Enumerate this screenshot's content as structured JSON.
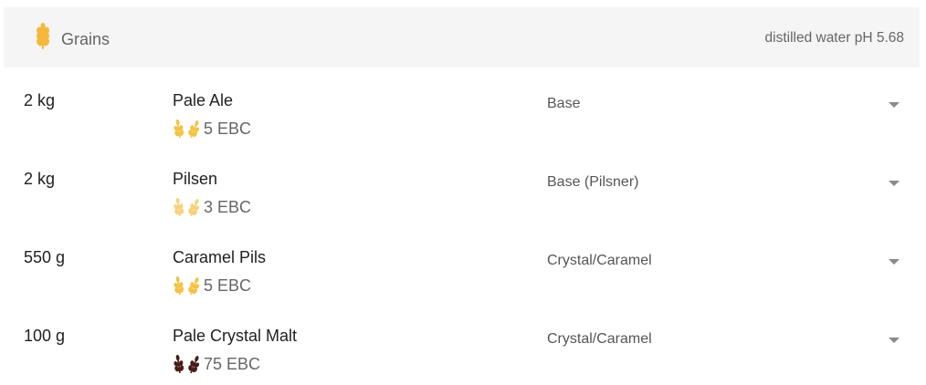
{
  "header": {
    "title": "Grains",
    "water_note": "distilled water pH 5.68",
    "icon": "grain-icon",
    "icon_color": "#f5b83d"
  },
  "grains": [
    {
      "amount": "2 kg",
      "name": "Pale Ale",
      "color": "5 EBC",
      "type": "Base",
      "icon": "wheat-icon",
      "icon_color": "#f5c242"
    },
    {
      "amount": "2 kg",
      "name": "Pilsen",
      "color": "3 EBC",
      "type": "Base (Pilsner)",
      "icon": "wheat-icon",
      "icon_color": "#f8d27a"
    },
    {
      "amount": "550 g",
      "name": "Caramel Pils",
      "color": "5 EBC",
      "type": "Crystal/Caramel",
      "icon": "wheat-icon",
      "icon_color": "#f5c242"
    },
    {
      "amount": "100 g",
      "name": "Pale Crystal Malt",
      "color": "75 EBC",
      "type": "Crystal/Caramel",
      "icon": "wheat-icon",
      "icon_color": "#4a1c16"
    }
  ]
}
